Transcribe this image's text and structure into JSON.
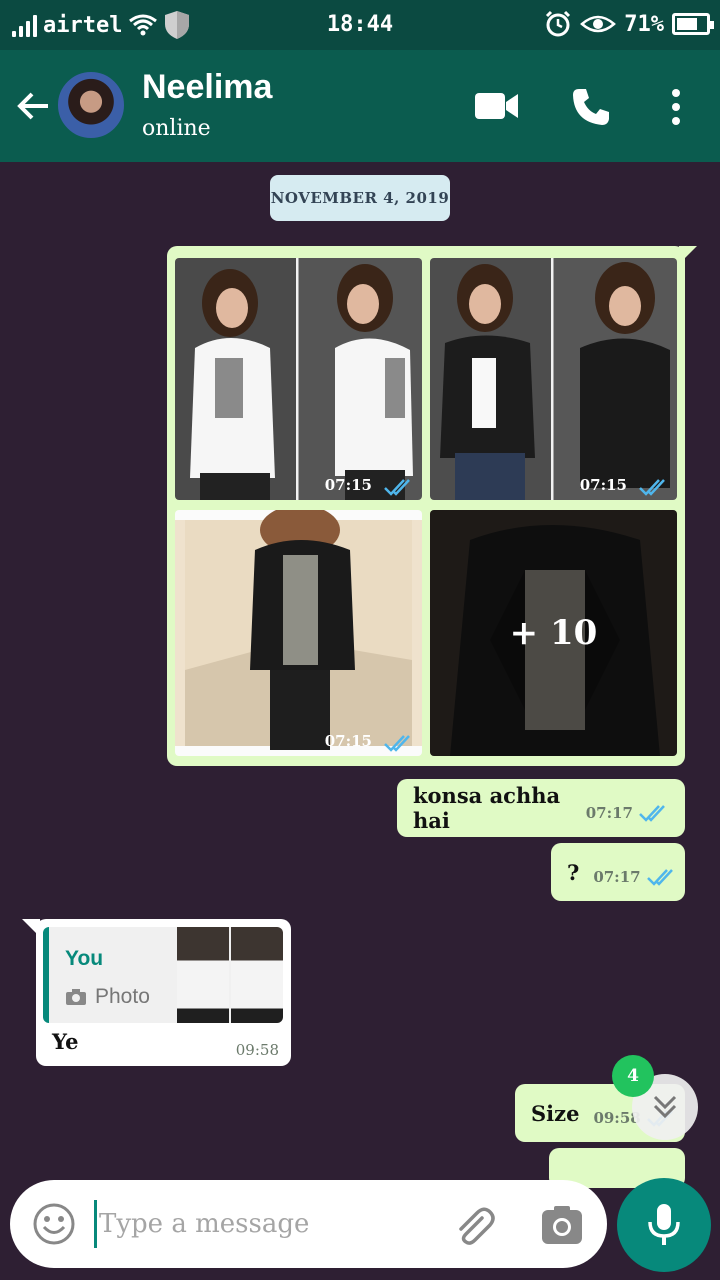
{
  "status_bar": {
    "carrier": "airtel",
    "time": "18:44",
    "battery_percent": "71%",
    "battery_level": 0.71
  },
  "header": {
    "contact_name": "Neelima",
    "contact_status": "online"
  },
  "chat": {
    "date_chip": "NOVEMBER 4, 2019",
    "album": {
      "photos": [
        {
          "time": "07:15",
          "status": "read"
        },
        {
          "time": "07:15",
          "status": "read"
        },
        {
          "time": "07:15",
          "status": "read"
        },
        {
          "overlay": "+ 10"
        }
      ]
    },
    "messages": [
      {
        "direction": "outgoing",
        "text": "konsa achha hai",
        "time": "07:17",
        "status": "read"
      },
      {
        "direction": "outgoing",
        "text": "?",
        "time": "07:17",
        "status": "read"
      },
      {
        "direction": "incoming",
        "quote_author": "You",
        "quote_type": "Photo",
        "text": "Ye",
        "time": "09:58"
      },
      {
        "direction": "outgoing",
        "text": "Size",
        "time": "09:58",
        "status": "read"
      }
    ],
    "unread_count": "4"
  },
  "input": {
    "placeholder": "Type a message"
  },
  "colors": {
    "header": "#0b5c4f",
    "accent": "#07897b",
    "outgoing_bubble": "#e0fac5",
    "chat_background": "#2e1f33",
    "read_tick": "#4fb6ec"
  }
}
